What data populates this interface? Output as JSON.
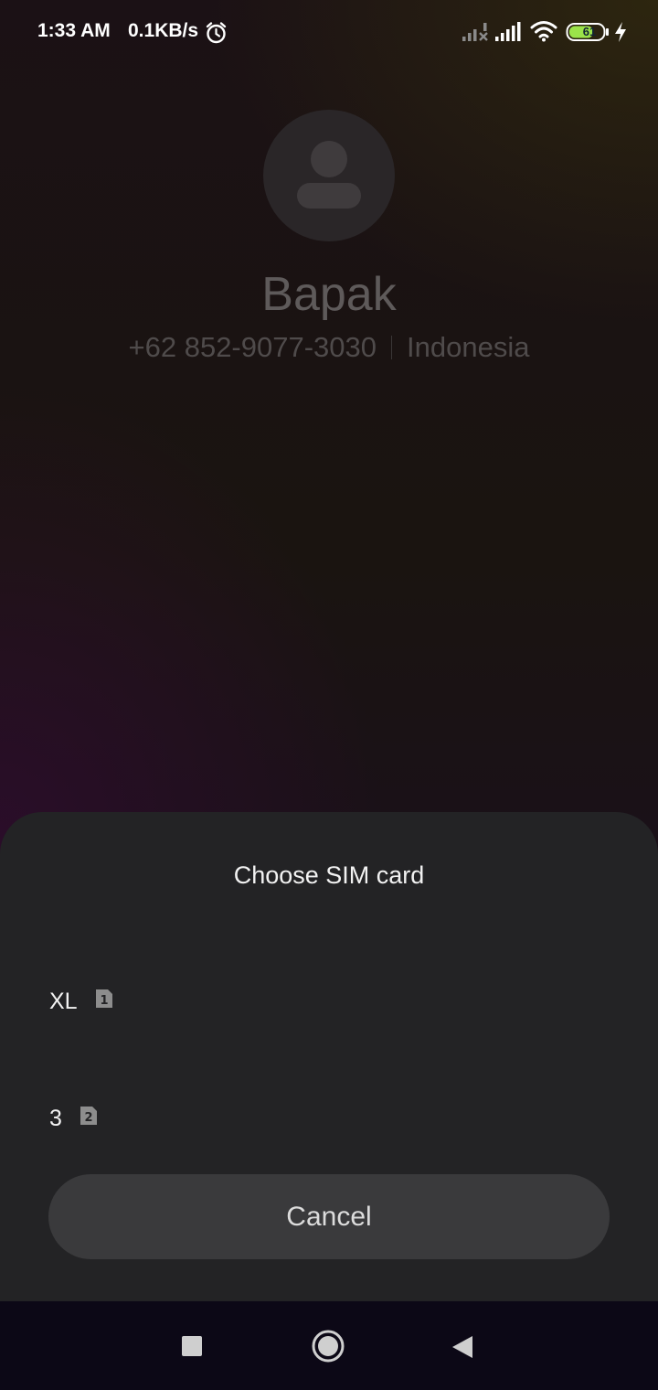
{
  "status_bar": {
    "time": "1:33 AM",
    "speed": "0.1KB/s",
    "battery": "61",
    "icons": [
      "alarm-icon",
      "signal-1-icon",
      "signal-2-icon",
      "wifi-icon",
      "battery-icon",
      "charging-bolt-icon"
    ]
  },
  "caller": {
    "name": "Bapak",
    "number": "+62 852-9077-3030",
    "location": "Indonesia",
    "avatar_icon": "person-icon"
  },
  "sheet": {
    "title": "Choose SIM card",
    "options": [
      {
        "label": "XL",
        "badge": "1"
      },
      {
        "label": "3",
        "badge": "2"
      }
    ],
    "cancel_label": "Cancel"
  },
  "nav_bar": {
    "icons": [
      "recents-square-icon",
      "home-circle-icon",
      "back-triangle-icon"
    ]
  },
  "colors": {
    "sheet_bg": "#232325",
    "button_bg": "#3a3a3c",
    "battery_fill": "#9be34a"
  }
}
